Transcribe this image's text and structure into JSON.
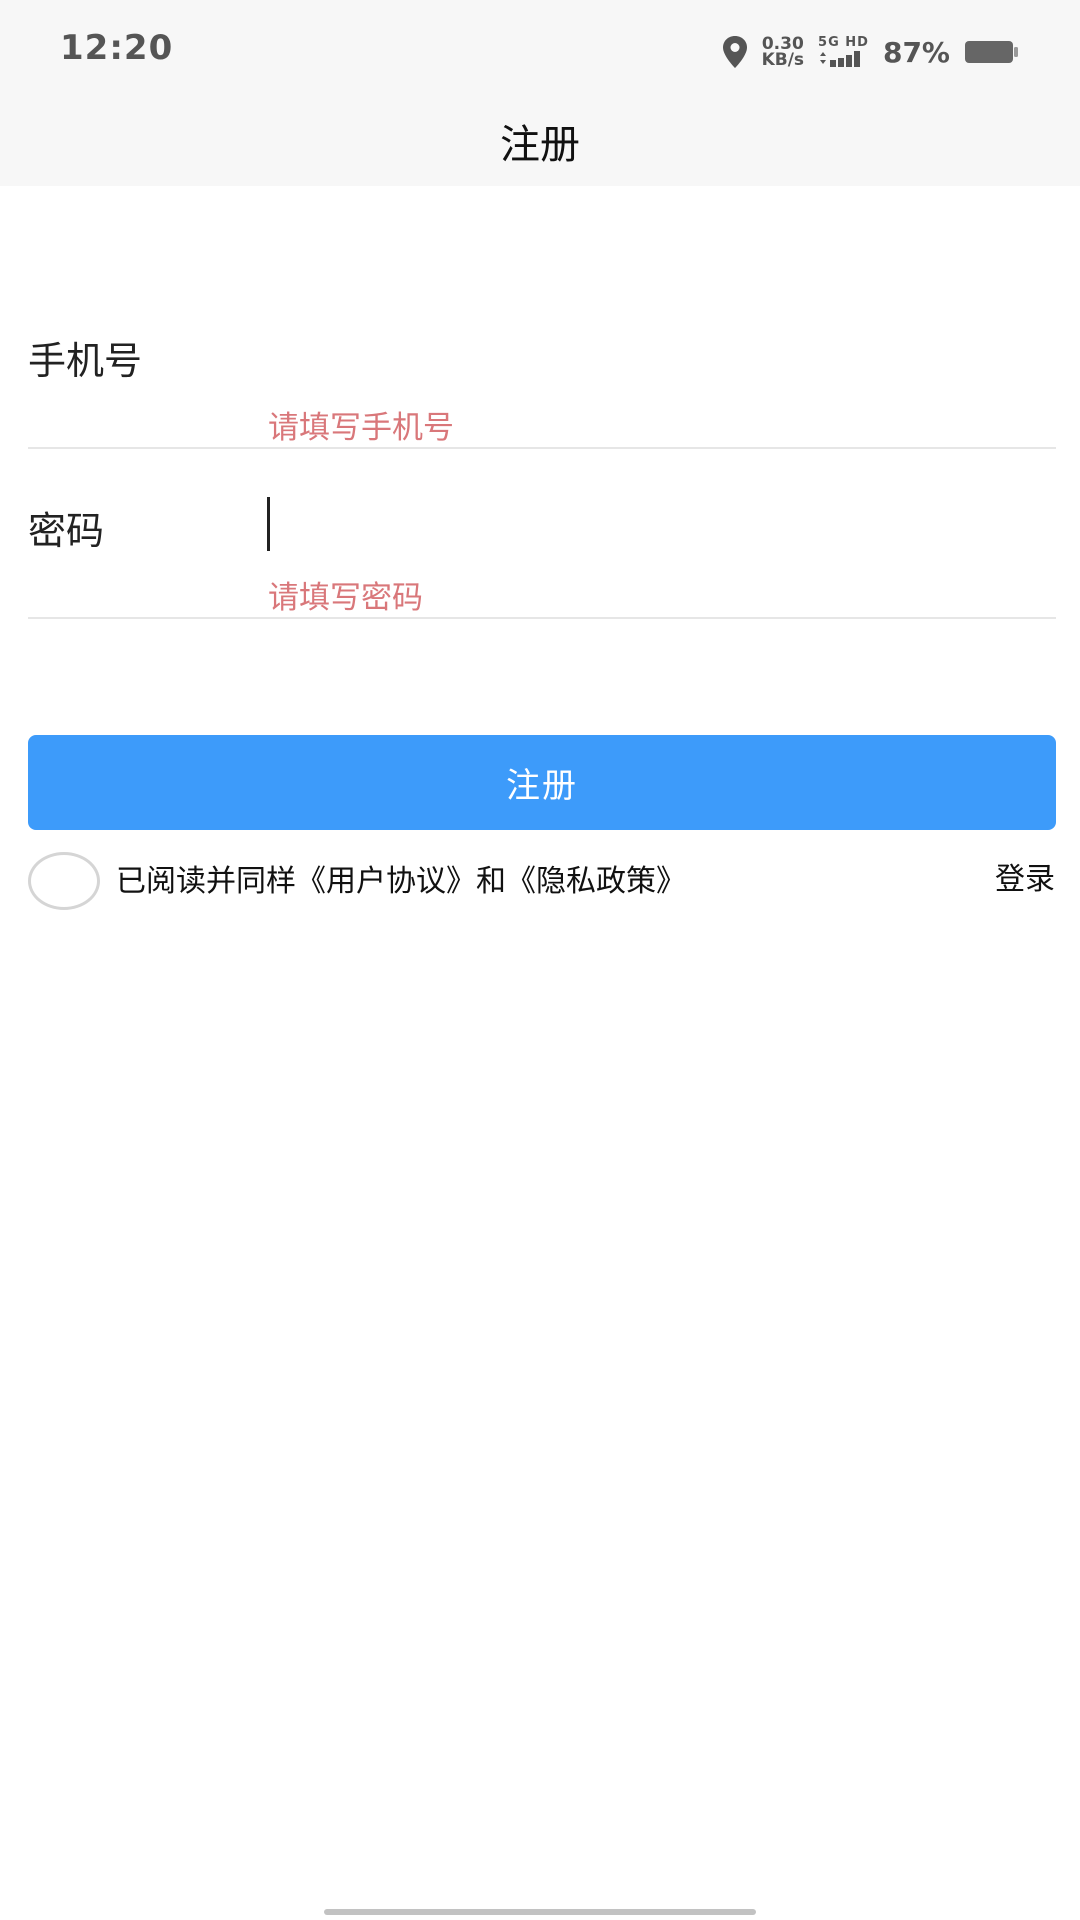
{
  "status_bar": {
    "time": "12:20",
    "net_speed_value": "0.30",
    "net_speed_unit": "KB/s",
    "network_label": "5G HD",
    "battery_percent": "87%",
    "icons": [
      "location-icon",
      "signal-icon",
      "battery-icon"
    ]
  },
  "nav": {
    "title": "注册"
  },
  "form": {
    "phone": {
      "label": "手机号",
      "value": "",
      "error": "请填写手机号"
    },
    "password": {
      "label": "密码",
      "value": "",
      "error": "请填写密码"
    },
    "submit_label": "注册"
  },
  "agreement": {
    "text": "已阅读并同样《用户协议》和《隐私政策》",
    "checked": false
  },
  "login_link": "登录",
  "colors": {
    "primary": "#3d9bfa",
    "error_text": "#d9777a",
    "bar_background": "#f7f7f7"
  }
}
